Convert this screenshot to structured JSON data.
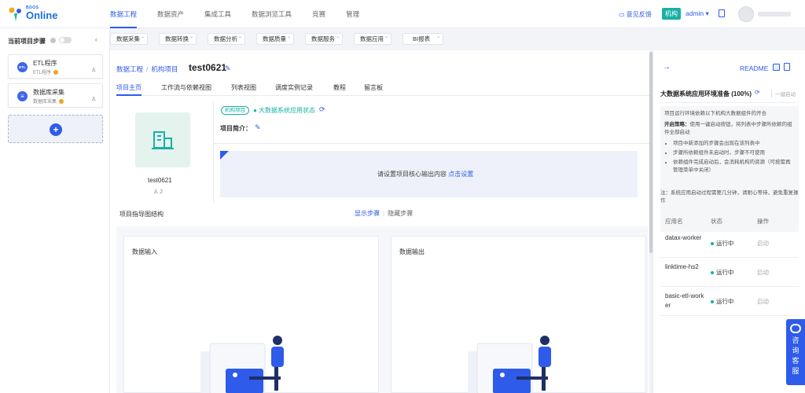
{
  "logo": {
    "small": "BDOS",
    "big": "Online"
  },
  "topnav": [
    "数据工程",
    "数据资产",
    "集成工具",
    "数据浏览工具",
    "竞赛",
    "管理"
  ],
  "header": {
    "feedback": "意见反馈",
    "org_badge": "机构",
    "user": "admin ▾"
  },
  "left_panel": {
    "title": "当前项目步骤",
    "collapse": "‹",
    "steps": [
      {
        "icon": "ETL",
        "name": "ETL程序",
        "sub": "ETL程序"
      },
      {
        "icon": "≡",
        "name": "数据库采集",
        "sub": "数据库采集"
      }
    ],
    "add": "+"
  },
  "subnav": [
    "数据采集",
    "数据转换",
    "数据分析",
    "数据质量",
    "数据服务",
    "数据应用",
    "BI报表"
  ],
  "breadcrumb": {
    "root": "数据工程",
    "parent": "机构项目",
    "current": "test0621"
  },
  "tabs": [
    "项目主页",
    "工作流与依赖视图",
    "列表视图",
    "调度实例记录",
    "教程",
    "留言板"
  ],
  "project": {
    "name": "test0621",
    "users": "2",
    "org_tag": "机构项目",
    "env_status": "● 大数据系统应用状态",
    "intro_label": "项目简介：",
    "output_prompt": "请设置项目核心输出内容",
    "output_link": "点击设置"
  },
  "guide": {
    "title": "项目指导图结构",
    "show": "显示步骤",
    "hide": "隐藏步骤",
    "input_title": "数据输入",
    "output_title": "数据输出"
  },
  "right_panel": {
    "readme": "README",
    "title": "大数据系统应用环境准备 (100%)",
    "onekey": "一键启动",
    "note_intro": "项目运行环境依赖以下机构大数据组件的开合",
    "strategy_label": "开启策略：",
    "strategy_text": "使用一键启动按钮，将列表中步骤所依赖的组件全部启动",
    "bullets": [
      "项目中新添加的步骤会出现在该列表中",
      "步骤所依赖组件未启动时，步骤不可使用",
      "依赖组件完成启动后，会消耗机构的资源（可按需再管理菜单中关闭）"
    ],
    "tip": "注：系统应用启动过程需要几分钟，请耐心等待，避免重复操作",
    "table_headers": [
      "应用名",
      "状态",
      "操作"
    ],
    "apps": [
      {
        "name": "datax-worker",
        "status": "运行中",
        "action": "启动"
      },
      {
        "name": "linktime-hs2",
        "status": "运行中",
        "action": "启动"
      },
      {
        "name": "basic-etl-worker",
        "status": "运行中",
        "action": "启动"
      }
    ]
  },
  "consult": "咨询客服",
  "colors": {
    "primary": "#2f5bea",
    "teal": "#17b1a5",
    "warning": "#f2a21d"
  },
  "icons": [
    "logo-icon",
    "message-icon",
    "doc-icon",
    "user-icon",
    "database-icon",
    "edit-icon",
    "refresh-icon",
    "building-icon",
    "arrow-right-icon",
    "chat-icon"
  ]
}
